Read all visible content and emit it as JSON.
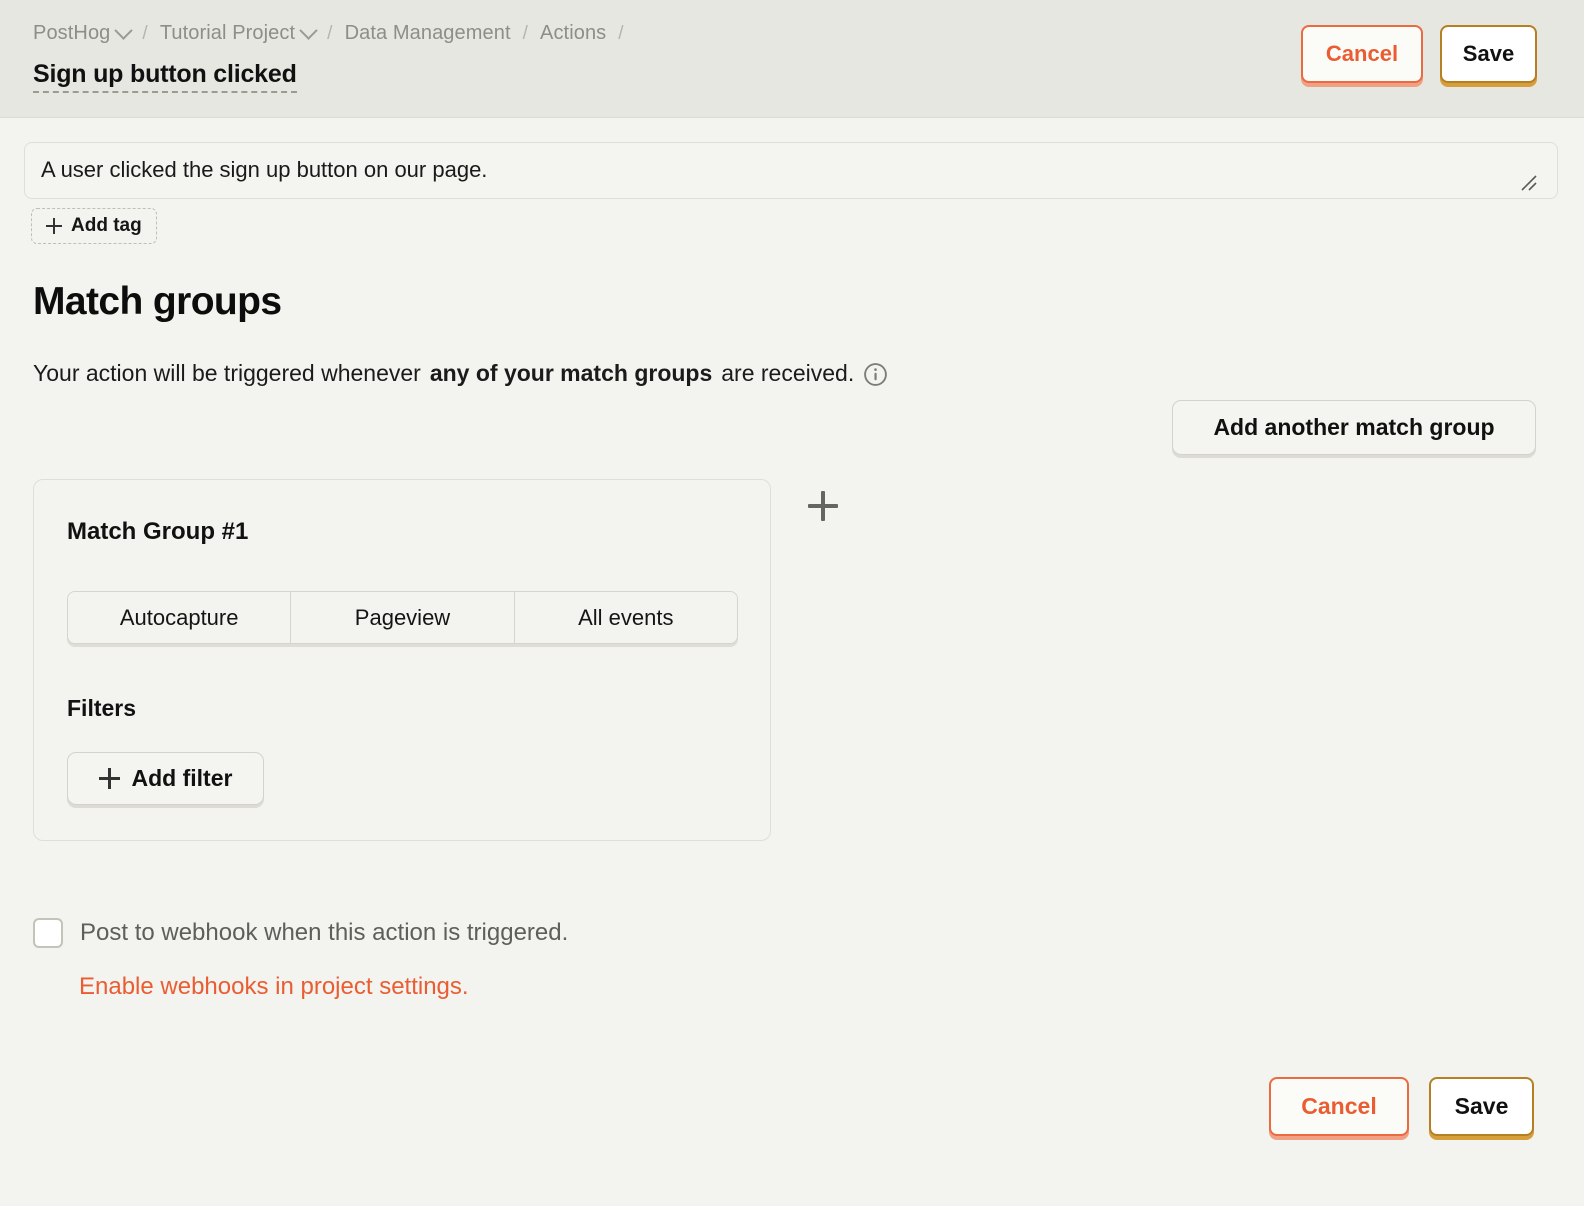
{
  "header": {
    "breadcrumbs": [
      {
        "label": "PostHog",
        "has_chevron": true
      },
      {
        "label": "Tutorial Project",
        "has_chevron": true
      },
      {
        "label": "Data Management",
        "has_chevron": false
      },
      {
        "label": "Actions",
        "has_chevron": false
      }
    ],
    "separator": "/",
    "title": "Sign up button clicked",
    "cancel_label": "Cancel",
    "save_label": "Save"
  },
  "description": {
    "value": "A user clicked the sign up button on our page.",
    "placeholder": "Description",
    "resize_handle_icon": "resize-grip-icon"
  },
  "tags": {
    "add_tag_label": "Add tag",
    "plus_icon": "plus-icon"
  },
  "match_groups": {
    "section_title": "Match groups",
    "description_prefix": "Your action will be triggered whenever ",
    "description_bold": "any of your match groups",
    "description_suffix": " are received.",
    "info_icon": "info-circle-icon",
    "add_group_label": "Add another match group",
    "add_icon": "plus-icon",
    "groups": [
      {
        "title": "Match Group #1",
        "segments": [
          "Autocapture",
          "Pageview",
          "All events"
        ],
        "selected_segment": "",
        "filters_label": "Filters",
        "add_filter_label": "Add filter"
      }
    ]
  },
  "webhook": {
    "checkbox_checked": false,
    "label": "Post to webhook when this action is triggered.",
    "link_label": "Enable webhooks in project settings."
  },
  "footer": {
    "cancel_label": "Cancel",
    "save_label": "Save"
  },
  "colors": {
    "accent_orange": "#ea5d32",
    "save_border_gold": "#b58024",
    "page_background": "#f3f3ef",
    "header_background": "#e7e7e2"
  }
}
